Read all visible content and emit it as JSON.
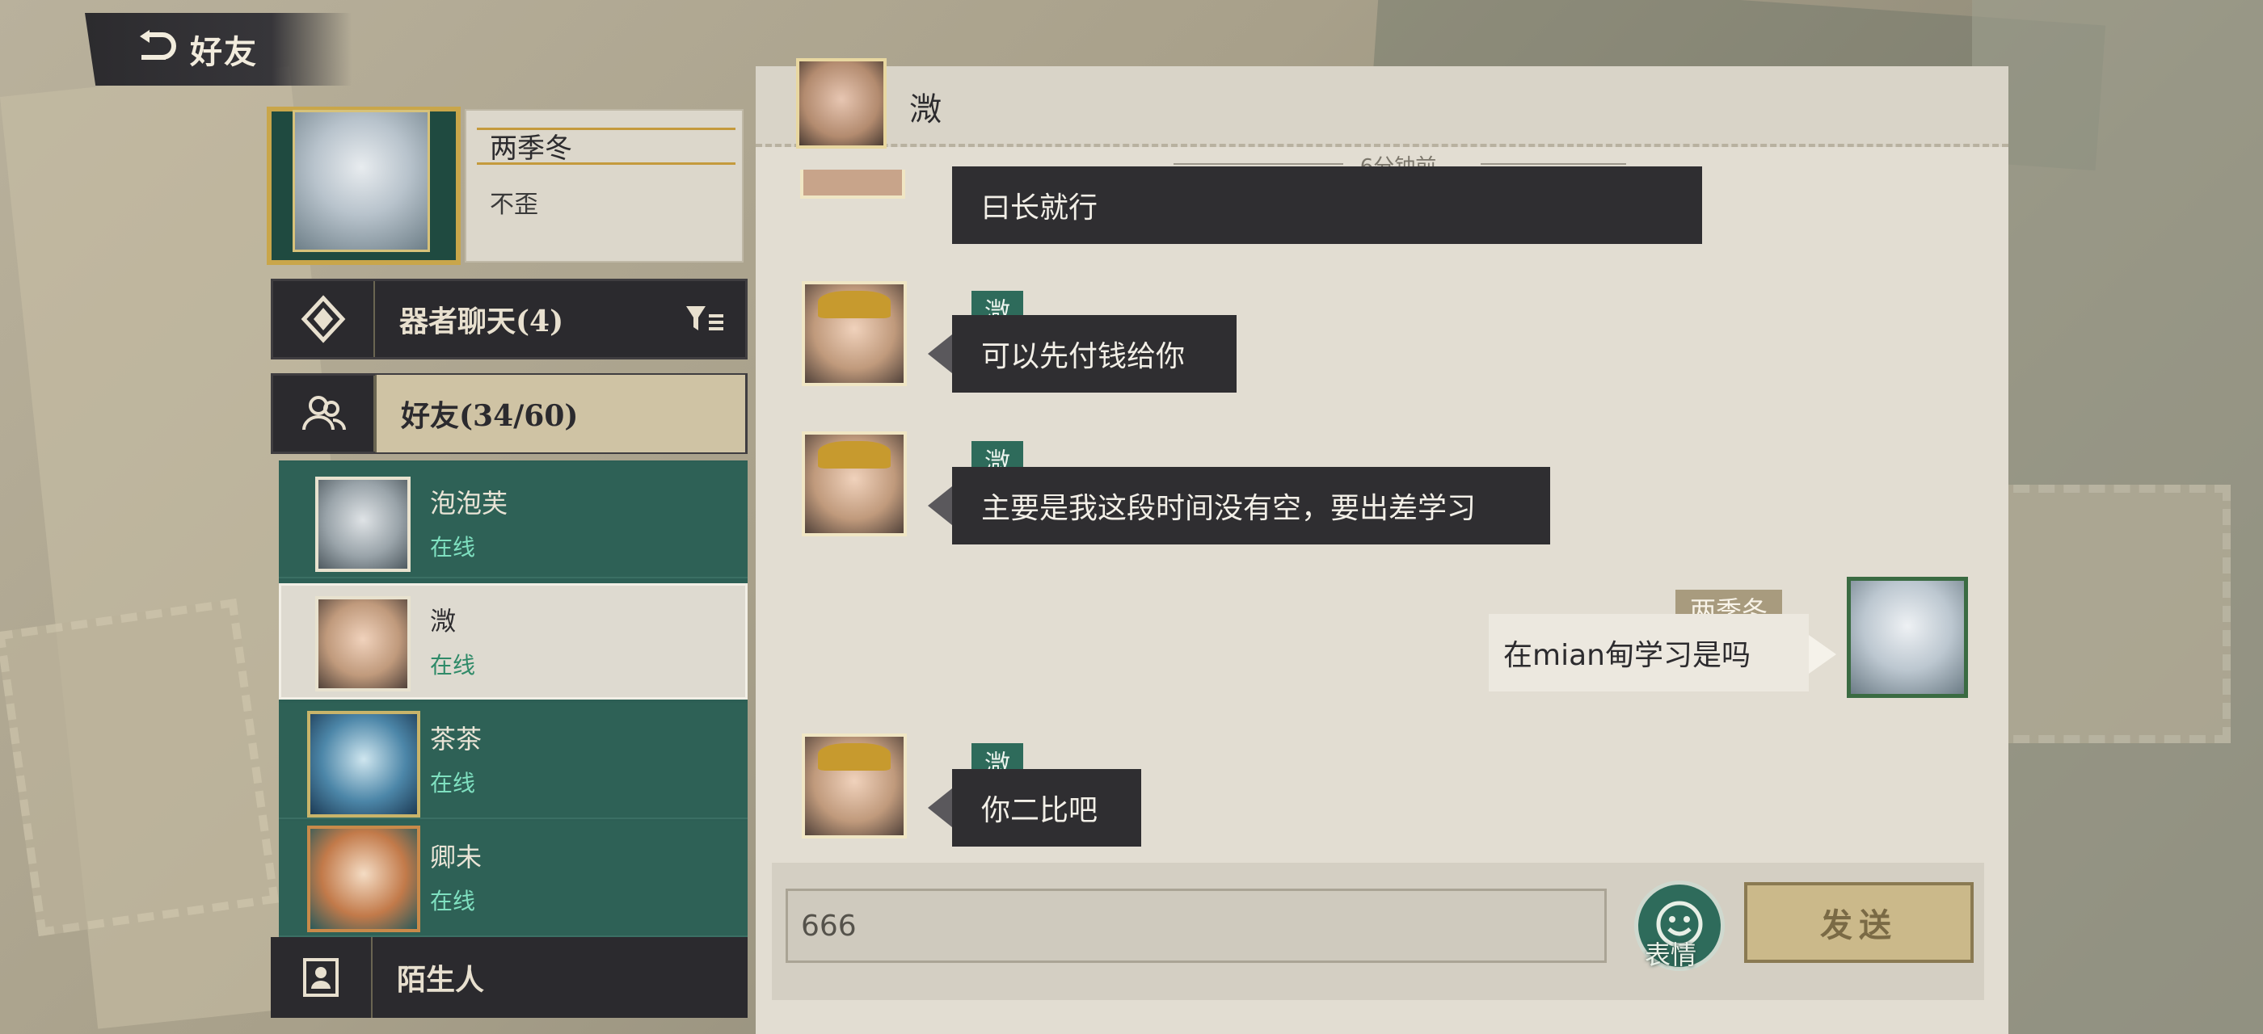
{
  "header": {
    "back_title": "好友"
  },
  "profile": {
    "name": "两季冬",
    "signature": "不歪"
  },
  "categories": {
    "chat_label": "器者聊天(4)",
    "friends_label": "好友(34/60)",
    "strangers_label": "陌生人"
  },
  "friends": [
    {
      "name": "泡泡芙",
      "status": "在线"
    },
    {
      "name": "溦",
      "status": "在线"
    },
    {
      "name": "茶茶",
      "status": "在线"
    },
    {
      "name": "卿未",
      "status": "在线"
    }
  ],
  "chat": {
    "contact_name": "溦",
    "timestamp": "6分钟前",
    "messages": [
      {
        "sender": "",
        "text": "曰长就行"
      },
      {
        "sender": "溦",
        "text": "可以先付钱给你"
      },
      {
        "sender": "溦",
        "text": "主要是我这段时间没有空，要出差学习"
      },
      {
        "sender": "两季冬",
        "text": "在mian甸学习是吗"
      },
      {
        "sender": "溦",
        "text": "你二比吧"
      }
    ]
  },
  "input": {
    "value": "666",
    "emoji_label": "表情",
    "send_label": "发送"
  },
  "colors": {
    "accent_green": "#2e6b5b",
    "panel_dark": "#2b2a2e",
    "gold": "#c9a64a"
  }
}
